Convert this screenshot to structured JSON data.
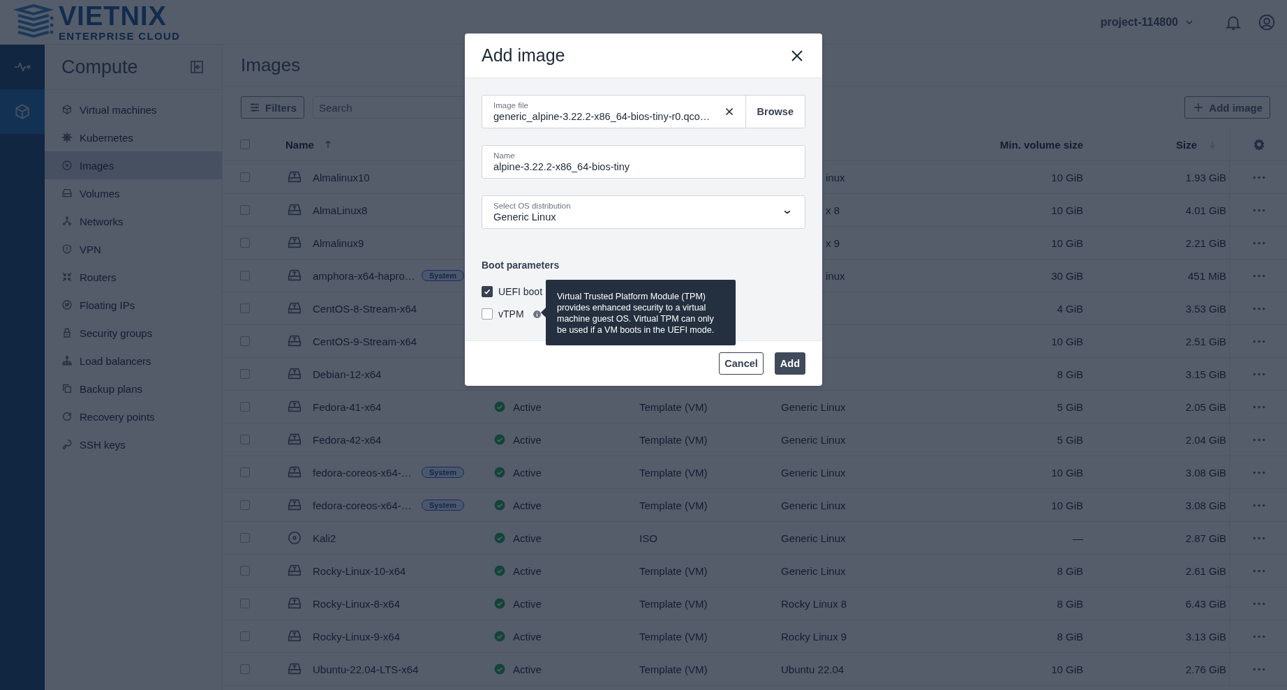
{
  "header": {
    "logo_title": "VIETNIX",
    "logo_subtitle": "ENTERPRISE CLOUD",
    "project": "project-114800"
  },
  "rail": [
    {
      "kind": "pulse",
      "selected": false
    },
    {
      "kind": "cube",
      "selected": true
    }
  ],
  "sidebar": {
    "title": "Compute",
    "items": [
      {
        "label": "Virtual machines",
        "kind": "cube",
        "selected": false
      },
      {
        "label": "Kubernetes",
        "kind": "wheel",
        "selected": false
      },
      {
        "label": "Images",
        "kind": "disc",
        "selected": true
      },
      {
        "label": "Volumes",
        "kind": "drive",
        "selected": false
      },
      {
        "label": "Networks",
        "kind": "nodes",
        "selected": false
      },
      {
        "label": "VPN",
        "kind": "shield",
        "selected": false
      },
      {
        "label": "Routers",
        "kind": "arrows",
        "selected": false
      },
      {
        "label": "Floating IPs",
        "kind": "ip",
        "selected": false
      },
      {
        "label": "Security groups",
        "kind": "lock",
        "selected": false
      },
      {
        "label": "Load balancers",
        "kind": "hierarchy",
        "selected": false
      },
      {
        "label": "Backup plans",
        "kind": "copy",
        "selected": false
      },
      {
        "label": "Recovery points",
        "kind": "refresh",
        "selected": false
      },
      {
        "label": "SSH keys",
        "kind": "key",
        "selected": false
      }
    ]
  },
  "page": {
    "title": "Images",
    "filters": "Filters",
    "search_placeholder": "Search",
    "add_button": "Add image"
  },
  "table": {
    "header": {
      "name": "Name",
      "name_sorted": true,
      "min_volume": "Min. volume size",
      "size": "Size",
      "size_sorted": false,
      "checked": false
    },
    "rows": [
      {
        "checked": false,
        "kind": "template",
        "name": "Almalinux10",
        "os_fragment": "inux",
        "min_volume": "10 GiB",
        "size": "1.93 GiB"
      },
      {
        "checked": false,
        "kind": "template",
        "name": "AlmaLinux8",
        "os_fragment": "x 8",
        "min_volume": "10 GiB",
        "size": "4.01 GiB"
      },
      {
        "checked": false,
        "kind": "template",
        "name": "Almalinux9",
        "os_fragment": "x 9",
        "min_volume": "10 GiB",
        "size": "2.21 GiB"
      },
      {
        "checked": false,
        "kind": "template",
        "name": "amphora-x64-hapro…",
        "badge": "System",
        "os_fragment": "inux",
        "min_volume": "30 GiB",
        "size": "451 MiB"
      },
      {
        "checked": false,
        "kind": "template",
        "name": "CentOS-8-Stream-x64",
        "min_volume": "4 GiB",
        "size": "3.53 GiB"
      },
      {
        "checked": false,
        "kind": "template",
        "name": "CentOS-9-Stream-x64",
        "min_volume": "10 GiB",
        "size": "2.51 GiB"
      },
      {
        "checked": false,
        "kind": "template",
        "name": "Debian-12-x64",
        "min_volume": "8 GiB",
        "size": "3.15 GiB"
      },
      {
        "checked": false,
        "kind": "template",
        "name": "Fedora-41-x64",
        "status": "Active",
        "type": "Template (VM)",
        "os": "Generic Linux",
        "min_volume": "5 GiB",
        "size": "2.05 GiB"
      },
      {
        "checked": false,
        "kind": "template",
        "name": "Fedora-42-x64",
        "status": "Active",
        "type": "Template (VM)",
        "os": "Generic Linux",
        "min_volume": "5 GiB",
        "size": "2.04 GiB"
      },
      {
        "checked": false,
        "kind": "template",
        "name": "fedora-coreos-x64-…",
        "badge": "System",
        "status": "Active",
        "type": "Template (VM)",
        "os": "Generic Linux",
        "min_volume": "10 GiB",
        "size": "3.08 GiB"
      },
      {
        "checked": false,
        "kind": "template",
        "name": "fedora-coreos-x64-…",
        "badge": "System",
        "status": "Active",
        "type": "Template (VM)",
        "os": "Generic Linux",
        "min_volume": "10 GiB",
        "size": "3.08 GiB"
      },
      {
        "checked": false,
        "kind": "iso",
        "name": "Kali2",
        "status": "Active",
        "type": "ISO",
        "os": "Generic Linux",
        "min_volume": "—",
        "size": "2.87 GiB"
      },
      {
        "checked": false,
        "kind": "template",
        "name": "Rocky-Linux-10-x64",
        "status": "Active",
        "type": "Template (VM)",
        "os": "Generic Linux",
        "min_volume": "8 GiB",
        "size": "2.61 GiB"
      },
      {
        "checked": false,
        "kind": "template",
        "name": "Rocky-Linux-8-x64",
        "status": "Active",
        "type": "Template (VM)",
        "os": "Rocky Linux 8",
        "min_volume": "8 GiB",
        "size": "6.43 GiB"
      },
      {
        "checked": false,
        "kind": "template",
        "name": "Rocky-Linux-9-x64",
        "status": "Active",
        "type": "Template (VM)",
        "os": "Rocky Linux 9",
        "min_volume": "8 GiB",
        "size": "3.13 GiB"
      },
      {
        "checked": false,
        "kind": "template",
        "name": "Ubuntu-22.04-LTS-x64",
        "status": "Active",
        "type": "Template (VM)",
        "os": "Ubuntu 22.04",
        "min_volume": "10 GiB",
        "size": "2.76 GiB"
      }
    ]
  },
  "modal": {
    "title": "Add image",
    "fields": [
      {
        "kind": "file",
        "label": "Image file",
        "value": "generic_alpine-3.22.2-x86_64-bios-tiny-r0.qco…",
        "button": "Browse"
      },
      {
        "kind": "text",
        "label": "Name",
        "value": "alpine-3.22.2-x86_64-bios-tiny"
      },
      {
        "kind": "select",
        "label": "Select OS distribution",
        "value": "Generic Linux"
      }
    ],
    "section": "Boot parameters",
    "options": [
      {
        "label": "UEFI boot",
        "checked": true,
        "info": false
      },
      {
        "label": "vTPM",
        "checked": false,
        "info": true
      }
    ],
    "tooltip": "Virtual Trusted Platform Module (TPM) provides enhanced security to a virtual machine guest OS. Virtual TPM can only be used if a VM boots in the UEFI mode.",
    "buttons": [
      {
        "label": "Cancel",
        "kind": "secondary"
      },
      {
        "label": "Add",
        "kind": "primary"
      }
    ]
  }
}
